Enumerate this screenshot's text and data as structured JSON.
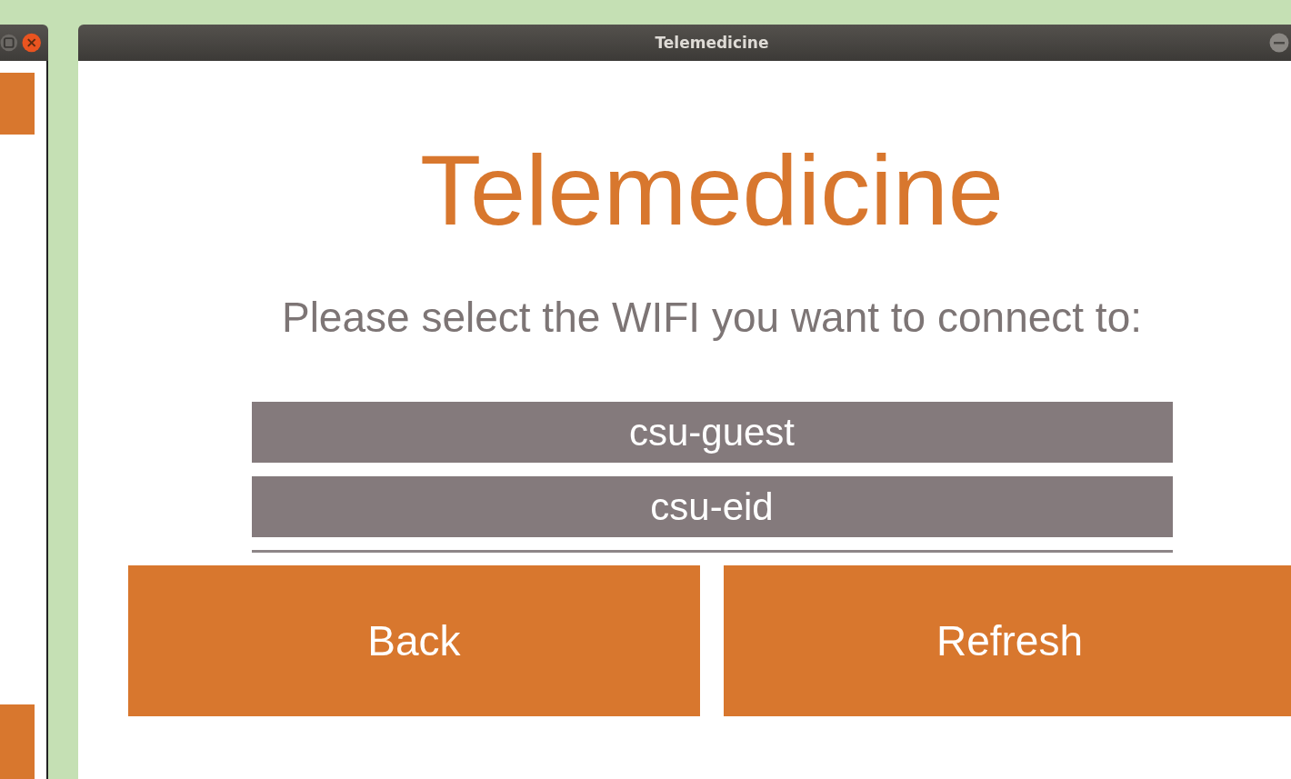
{
  "window": {
    "title": "Telemedicine"
  },
  "heading": "Telemedicine",
  "prompt": "Please select the WIFI you want to connect to:",
  "wifi_networks": [
    {
      "name": "csu-guest"
    },
    {
      "name": "csu-eid"
    }
  ],
  "buttons": [
    {
      "label": "Back"
    },
    {
      "label": "Refresh"
    }
  ]
}
